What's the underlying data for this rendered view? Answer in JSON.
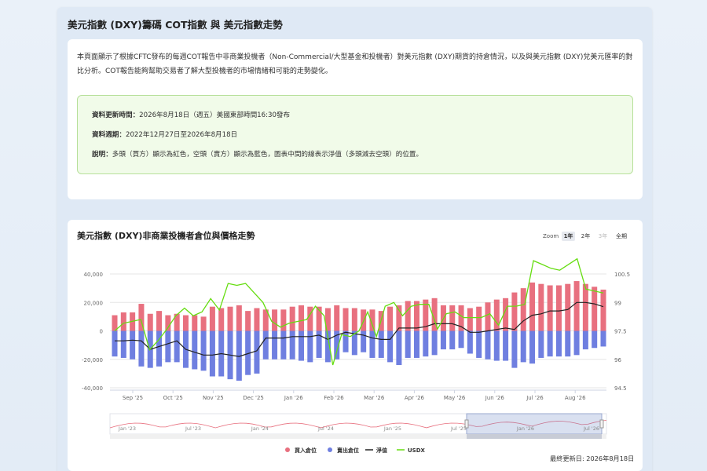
{
  "header": {
    "title": "美元指數 (DXY)籌碼 COT指數 與 美元指數走勢"
  },
  "intro": {
    "text": "本頁面顯示了根據CFTC發布的每週COT報告中非商業投機者（Non-Commercial/大型基金和投機者）對美元指數 (DXY)期貨的持倉情況，以及與美元指數 (DXY)兌美元匯率的對比分析。COT報告能夠幫助交易者了解大型投機者的市場情緒和可能的走勢變化。"
  },
  "notice": {
    "update_label": "資料更新時間：",
    "update_value": "2026年8月18日（週五）美國東部時間16:30發布",
    "period_label": "資料週期：",
    "period_value": "2022年12月27日至2026年8月18日",
    "desc_label": "說明：",
    "desc_value": "多頭（買方）顯示為紅色，空頭（賣方）顯示為藍色，圖表中間的線表示淨值（多頭減去空頭）的位置。"
  },
  "chart_section": {
    "title": "美元指數 (DXY)非商業投機者倉位與價格走勢",
    "zoom_label": "Zoom",
    "zoom_buttons": [
      "1年",
      "2年",
      "3年",
      "全期"
    ],
    "zoom_active": "1年",
    "zoom_disabled": "3年",
    "last_updated": "最終更新日: 2026年8月18日"
  },
  "colors": {
    "long": "#e8707f",
    "short": "#6f7fe0",
    "net": "#222222",
    "usdx": "#66dd11"
  },
  "chart_data": {
    "type": "bar",
    "title": "美元指數 (DXY)非商業投機者倉位與價格走勢",
    "x_tick_labels": [
      "Sep '25",
      "Oct '25",
      "Nov '25",
      "Dec '25",
      "Jan '26",
      "Feb '26",
      "Mar '26",
      "Apr '26",
      "May '26",
      "Jun '26",
      "Jul '26",
      "Aug '26"
    ],
    "y_left": {
      "ticks": [
        "40,000",
        "20,000",
        "0",
        "-20,000",
        "-40,000"
      ],
      "range": [
        -40000,
        40000
      ]
    },
    "y_right": {
      "ticks": [
        "100.5",
        "99",
        "97.5",
        "96",
        "94.5"
      ],
      "range": [
        94.5,
        100.5
      ]
    },
    "legend": [
      "買入倉位",
      "賣出倉位",
      "淨值",
      "USDX"
    ],
    "series": [
      {
        "name": "買入倉位",
        "values": [
          11000,
          13000,
          13000,
          19000,
          12000,
          14000,
          11000,
          12000,
          11000,
          11000,
          10000,
          17000,
          16000,
          17000,
          18000,
          14000,
          16000,
          15000,
          15000,
          15000,
          17000,
          18000,
          17000,
          17000,
          16000,
          18000,
          16000,
          16000,
          15000,
          15000,
          14000,
          17000,
          18000,
          21000,
          21000,
          22000,
          23000,
          18000,
          18000,
          18000,
          16000,
          17000,
          20000,
          22000,
          23000,
          27000,
          30000,
          34000,
          33000,
          32000,
          32000,
          33000,
          35000,
          33000,
          31000,
          29000
        ]
      },
      {
        "name": "賣出倉位",
        "values": [
          -18000,
          -19000,
          -20000,
          -25000,
          -26000,
          -25000,
          -22000,
          -22000,
          -26000,
          -27000,
          -28000,
          -32000,
          -32000,
          -34000,
          -35000,
          -31000,
          -30000,
          -20000,
          -20000,
          -20000,
          -20000,
          -21000,
          -22000,
          -19000,
          -22000,
          -20000,
          -15000,
          -17000,
          -15000,
          -19000,
          -19000,
          -22000,
          -24000,
          -19000,
          -19000,
          -18000,
          -17000,
          -13000,
          -13000,
          -12000,
          -16000,
          -19000,
          -20000,
          -21000,
          -21000,
          -26000,
          -22000,
          -23000,
          -19000,
          -18000,
          -18000,
          -18000,
          -17000,
          -13000,
          -12000,
          -11000
        ]
      },
      {
        "name": "淨值",
        "values": [
          -7000,
          -7000,
          -6500,
          -7000,
          -13000,
          -11000,
          -9000,
          -7000,
          -13000,
          -15000,
          -17000,
          -17000,
          -16000,
          -17000,
          -18000,
          -16000,
          -14000,
          -5000,
          -5000,
          -5000,
          -4000,
          -4000,
          -4000,
          -3000,
          -6000,
          -3000,
          -1000,
          -2000,
          -3000,
          -5000,
          -6000,
          -6000,
          2000,
          2000,
          2000,
          3000,
          5000,
          5000,
          5000,
          3000,
          -1000,
          -1000,
          0,
          1000,
          2000,
          1000,
          7000,
          11000,
          12000,
          14000,
          14000,
          15000,
          20000,
          20000,
          19000,
          17000
        ]
      },
      {
        "name": "USDX",
        "values": [
          97.5,
          97.9,
          98.0,
          98.1,
          96.5,
          97.0,
          97.6,
          98.3,
          98.7,
          98.3,
          98.5,
          99.2,
          98.6,
          100.0,
          99.9,
          100.0,
          99.5,
          99.0,
          98.0,
          97.7,
          97.9,
          98.0,
          98.1,
          98.8,
          98.3,
          95.7,
          97.3,
          97.2,
          97.5,
          98.5,
          97.2,
          98.8,
          99.0,
          98.3,
          98.8,
          98.9,
          98.9,
          97.6,
          98.4,
          98.5,
          98.2,
          98.2,
          98.2,
          98.4,
          97.8,
          98.8,
          98.8,
          98.9,
          101.2,
          101.0,
          100.8,
          100.7,
          101.0,
          101.3,
          99.7,
          99.6,
          99.5
        ]
      }
    ],
    "navigator_labels": [
      "Jan '23",
      "Jul '23",
      "Jan '24",
      "Jul '24",
      "Jan '25",
      "Jul '25",
      "Jan '26",
      "Jul '26"
    ]
  }
}
